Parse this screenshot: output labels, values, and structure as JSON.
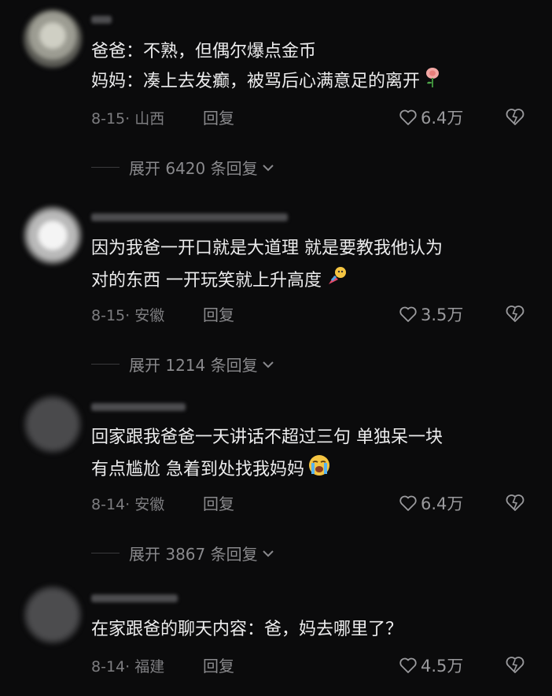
{
  "comments": [
    {
      "lines": [
        "爸爸：不熟，但偶尔爆点金币",
        "妈妈：凑上去发癫，被骂后心满意足的离开"
      ],
      "meta": "8-15· 山西",
      "reply_label": "回复",
      "likes": "6.4万",
      "emoji": "rose-emoji",
      "expand_label": "展开 6420 条回复"
    },
    {
      "lines": [
        "因为我爸一开口就是大道理 就是要教我他认为",
        "对的东西 一开玩笑就上升高度"
      ],
      "meta": "8-15· 安徽",
      "reply_label": "回复",
      "likes": "3.5万",
      "emoji": "rocket-emoji",
      "expand_label": "展开 1214 条回复"
    },
    {
      "lines": [
        "回家跟我爸爸一天讲话不超过三句 单独呆一块",
        "有点尴尬 急着到处找我妈妈"
      ],
      "meta": "8-14· 安徽",
      "reply_label": "回复",
      "likes": "6.4万",
      "emoji": "crying-face-emoji",
      "expand_label": "展开 3867 条回复"
    },
    {
      "lines": [
        "在家跟爸的聊天内容：爸，妈去哪里了？"
      ],
      "meta": "8-14· 福建",
      "reply_label": "回复",
      "likes": "4.5万"
    }
  ],
  "colors": {
    "background": "#0b0b0c",
    "text": "#ececed",
    "muted": "#8a8a8d"
  }
}
